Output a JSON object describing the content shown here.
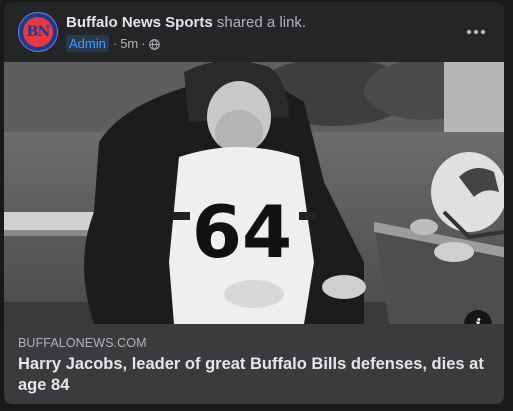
{
  "post": {
    "author": "Buffalo News Sports",
    "action": "shared a link.",
    "role_badge": "Admin",
    "time": "5m",
    "separator": "·",
    "avatar_text": "BN",
    "more_icon": "more-horizontal-icon",
    "privacy_icon": "globe-icon"
  },
  "photo": {
    "jersey_number": "64",
    "info_label": "i"
  },
  "link": {
    "domain": "BUFFALONEWS.COM",
    "title": "Harry Jacobs, leader of great Buffalo Bills defenses, dies at age 84"
  }
}
